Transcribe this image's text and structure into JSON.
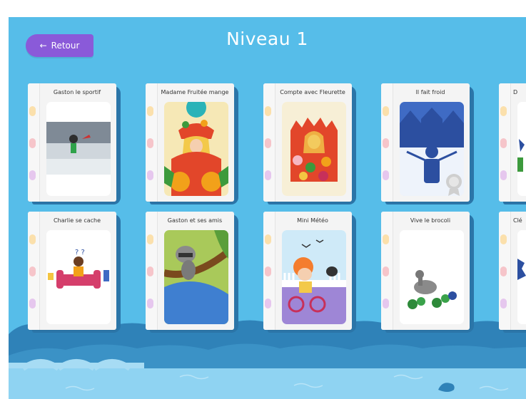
{
  "header": {
    "back_label": "Retour",
    "back_arrow": "←",
    "title": "Niveau 1"
  },
  "books": [
    {
      "title": "Gaston le sportif",
      "illustration": "cat-runner-photo"
    },
    {
      "title": "Madame Fruitée mange",
      "illustration": "fruit-lady"
    },
    {
      "title": "Compte avec Fleurette",
      "illustration": "flower-girl"
    },
    {
      "title": "Il fait froid",
      "illustration": "snow-girl",
      "completed": true,
      "check": "✔"
    },
    {
      "title": "D",
      "illustration": "partial"
    },
    {
      "title": "Charlie se cache",
      "illustration": "boy-on-sofa"
    },
    {
      "title": "Gaston et ses amis",
      "illustration": "raccoon-tree"
    },
    {
      "title": "Mini Météo",
      "illustration": "boy-bicycle"
    },
    {
      "title": "Vive le brocoli",
      "illustration": "goose-broccoli"
    },
    {
      "title": "Clé",
      "illustration": "partial"
    }
  ],
  "colors": {
    "background": "#56bde9",
    "back_button": "#8a5ad9",
    "check_badge": "#9b1c56",
    "hills_dark": "#2f82b8",
    "water": "#8fd3f2"
  }
}
